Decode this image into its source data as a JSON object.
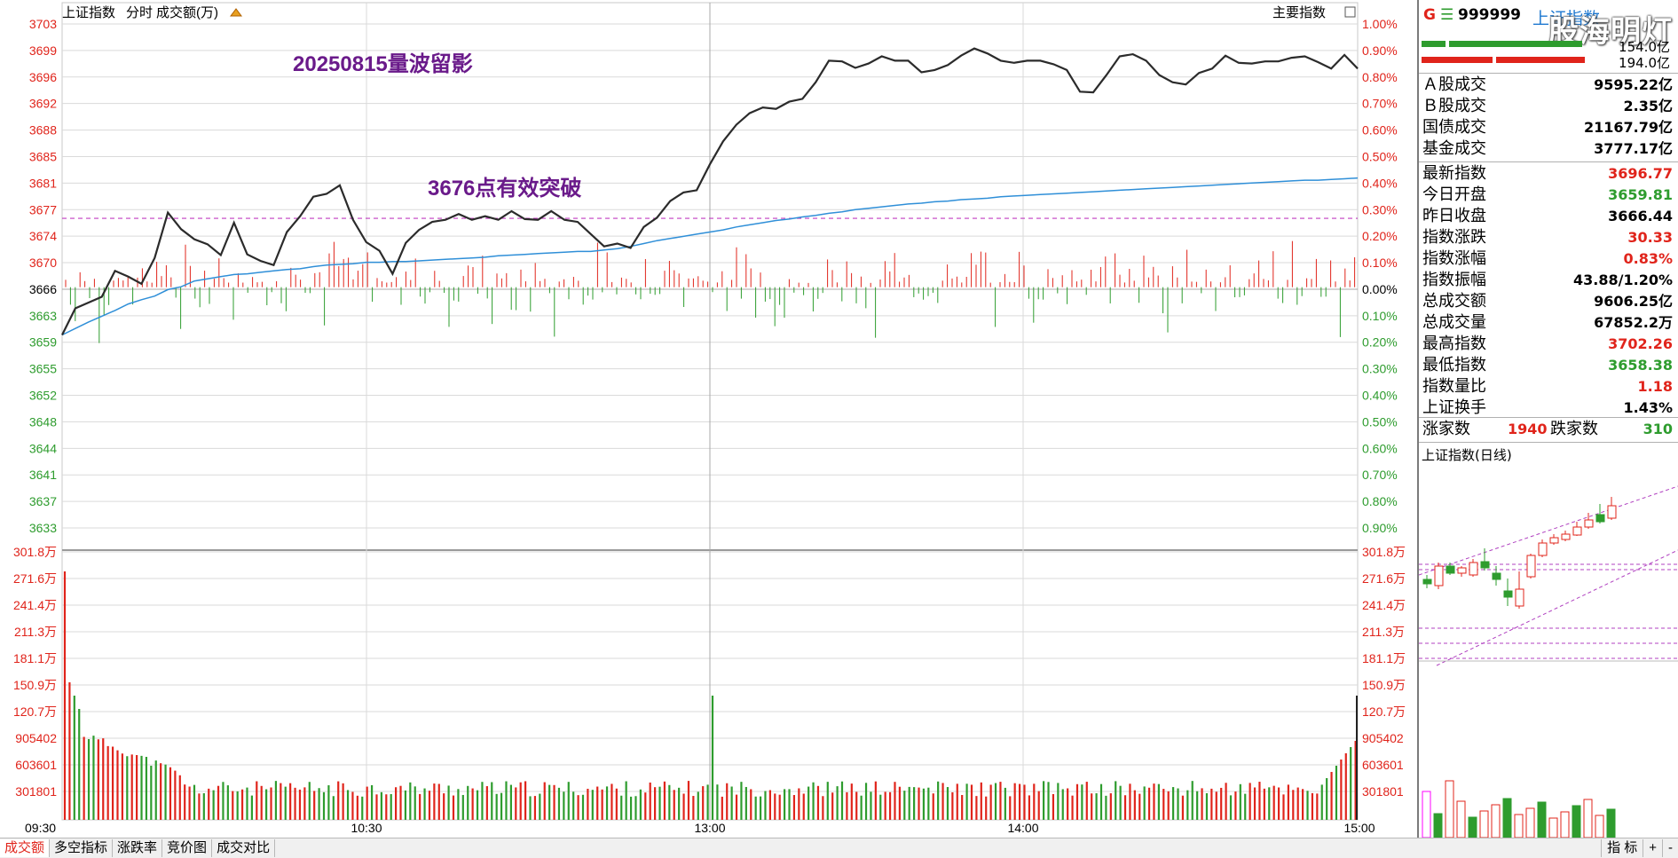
{
  "header": {
    "title": "上证指数",
    "mode": "分时",
    "volume_label": "成交额(万)",
    "indicator_button": "主要指数"
  },
  "annotations": {
    "top": "20250815量波留影",
    "middle": "3676点有效突破"
  },
  "price_axis": {
    "labels": [
      "3703",
      "3699",
      "3696",
      "3692",
      "3688",
      "3685",
      "3681",
      "3677",
      "3674",
      "3670",
      "3666",
      "3663",
      "3659",
      "3655",
      "3652",
      "3648",
      "3644",
      "3641",
      "3637",
      "3633"
    ],
    "pct_labels": [
      "1.00%",
      "0.90%",
      "0.80%",
      "0.70%",
      "0.60%",
      "0.50%",
      "0.40%",
      "0.30%",
      "0.20%",
      "0.10%",
      "0.00%",
      "0.10%",
      "0.20%",
      "0.30%",
      "0.40%",
      "0.50%",
      "0.60%",
      "0.70%",
      "0.80%",
      "0.90%"
    ],
    "prev_close": 3666.44,
    "breakout_level": 3676
  },
  "volume_axis": {
    "labels": [
      "301.8万",
      "271.6万",
      "241.4万",
      "211.3万",
      "181.1万",
      "150.9万",
      "120.7万",
      "905402",
      "603601",
      "301801"
    ]
  },
  "time_axis": {
    "labels": [
      "09:30",
      "10:30",
      "13:00",
      "14:00",
      "15:00"
    ]
  },
  "colors": {
    "up": "#e0241b",
    "down": "#2e9c2e",
    "price_line": "#2b2b2b",
    "avg_line": "#2f8fd8",
    "dash": "#c03cc0"
  },
  "chart_data": {
    "type": "line",
    "title": "",
    "xlabel": "",
    "ylabel": "",
    "ylim": [
      3633,
      3703
    ],
    "x_ticks": [
      "09:30",
      "10:30",
      "13:00",
      "14:00",
      "15:00"
    ],
    "series": [
      {
        "values": [
          3659.8,
          3663.5,
          3664.3,
          3665.1,
          3668.7,
          3667.9,
          3666.9,
          3670.5,
          3676.8,
          3674.5,
          3673.1,
          3672.4,
          3670.9,
          3675.4,
          3671.0,
          3670.1,
          3669.5,
          3674.1,
          3676.3,
          3679.0,
          3679.4,
          3680.6,
          3675.8,
          3672.7,
          3671.5,
          3668.3,
          3672.6,
          3674.4,
          3675.5,
          3675.8,
          3676.6,
          3675.8,
          3676.3,
          3675.8,
          3677.0,
          3675.9,
          3675.8,
          3677.0,
          3675.8,
          3675.5,
          3673.8,
          3672.1,
          3672.5,
          3671.9,
          3674.8,
          3676.1,
          3678.4,
          3679.6,
          3679.9,
          3683.5,
          3686.7,
          3689.0,
          3690.6,
          3691.4,
          3691.2,
          3692.2,
          3692.6,
          3694.9,
          3697.9,
          3697.8,
          3696.9,
          3697.5,
          3698.5,
          3697.9,
          3697.9,
          3696.3,
          3696.6,
          3697.3,
          3698.6,
          3699.6,
          3698.9,
          3697.9,
          3697.6,
          3697.9,
          3697.9,
          3697.4,
          3696.6,
          3693.6,
          3693.5,
          3695.9,
          3698.5,
          3698.8,
          3697.9,
          3695.9,
          3694.9,
          3694.6,
          3696.2,
          3696.8,
          3698.6,
          3697.6,
          3697.5,
          3697.8,
          3697.8,
          3698.3,
          3698.5,
          3697.7,
          3696.8,
          3698.7,
          3696.8
        ]
      },
      {
        "values": [
          3659.8,
          3660.7,
          3661.6,
          3662.4,
          3663.2,
          3664.1,
          3664.7,
          3665.2,
          3666.1,
          3666.5,
          3667.3,
          3667.6,
          3667.9,
          3668.2,
          3668.3,
          3668.5,
          3668.7,
          3668.9,
          3669.0,
          3669.3,
          3669.5,
          3669.6,
          3669.7,
          3669.9,
          3669.9,
          3670.0,
          3670.0,
          3670.1,
          3670.2,
          3670.3,
          3670.4,
          3670.5,
          3670.6,
          3670.8,
          3670.9,
          3671.0,
          3671.1,
          3671.2,
          3671.3,
          3671.4,
          3671.4,
          3671.6,
          3671.8,
          3672.1,
          3672.5,
          3672.9,
          3673.2,
          3673.5,
          3673.8,
          3674.1,
          3674.4,
          3674.8,
          3675.1,
          3675.4,
          3675.7,
          3675.9,
          3676.2,
          3676.4,
          3676.7,
          3676.9,
          3677.2,
          3677.4,
          3677.6,
          3677.8,
          3678.0,
          3678.1,
          3678.3,
          3678.4,
          3678.6,
          3678.7,
          3678.8,
          3679.0,
          3679.1,
          3679.2,
          3679.3,
          3679.4,
          3679.5,
          3679.6,
          3679.7,
          3679.8,
          3679.9,
          3680.0,
          3680.1,
          3680.2,
          3680.3,
          3680.4,
          3680.5,
          3680.6,
          3680.7,
          3680.8,
          3680.9,
          3681.0,
          3681.1,
          3681.2,
          3681.3,
          3681.3,
          3681.4,
          3681.5,
          3681.6
        ]
      }
    ]
  },
  "side": {
    "g": "G",
    "code": "999999",
    "name": "上证指数",
    "watermark": "股海明灯",
    "bar1_label": "154.0亿",
    "bar2_label": "194.0亿",
    "rows_a": [
      {
        "k": "Ａ股成交",
        "v": "9595.22亿",
        "c": "blk"
      },
      {
        "k": "Ｂ股成交",
        "v": "2.35亿",
        "c": "blk"
      },
      {
        "k": "国债成交",
        "v": "21167.79亿",
        "c": "blk"
      },
      {
        "k": "基金成交",
        "v": "3777.17亿",
        "c": "blk"
      }
    ],
    "rows_b": [
      {
        "k": "最新指数",
        "v": "3696.77",
        "c": "red"
      },
      {
        "k": "今日开盘",
        "v": "3659.81",
        "c": "green"
      },
      {
        "k": "昨日收盘",
        "v": "3666.44",
        "c": "blk"
      },
      {
        "k": "指数涨跌",
        "v": "30.33",
        "c": "red"
      },
      {
        "k": "指数涨幅",
        "v": "0.83%",
        "c": "red"
      },
      {
        "k": "指数振幅",
        "v": "43.88/1.20%",
        "c": "blk"
      },
      {
        "k": "总成交额",
        "v": "9606.25亿",
        "c": "blk"
      },
      {
        "k": "总成交量",
        "v": "67852.2万",
        "c": "blk"
      },
      {
        "k": "最高指数",
        "v": "3702.26",
        "c": "red"
      },
      {
        "k": "最低指数",
        "v": "3658.38",
        "c": "green"
      },
      {
        "k": "指数量比",
        "v": "1.18",
        "c": "red"
      },
      {
        "k": "上证换手",
        "v": "1.43%",
        "c": "blk"
      }
    ],
    "rise_label": "涨家数",
    "rise_value": "1940",
    "fall_label": "跌家数",
    "fall_value": "310",
    "kline_title": "上证指数(日线)"
  },
  "tabs": [
    "成交额",
    "多空指标",
    "涨跌率",
    "竞价图",
    "成交对比"
  ],
  "bottom_controls": [
    "指 标",
    "+",
    "-"
  ]
}
